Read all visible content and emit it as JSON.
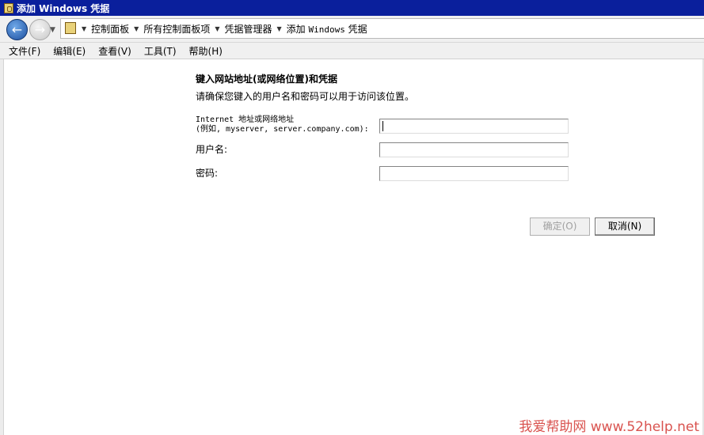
{
  "window": {
    "title": "添加 Windows 凭据"
  },
  "address_bar": {
    "crumbs": [
      "控制面板",
      "所有控制面板项",
      "凭据管理器"
    ],
    "current_prefix": "添加 ",
    "current_mono": "Windows",
    "current_suffix": " 凭据"
  },
  "menu": [
    "文件(F)",
    "编辑(E)",
    "查看(V)",
    "工具(T)",
    "帮助(H)"
  ],
  "form": {
    "heading": "键入网站地址(或网络位置)和凭据",
    "description": "请确保您键入的用户名和密码可以用于访问该位置。",
    "address_label_line1": "Internet 地址或网络地址",
    "address_label_line2": "(例如, myserver, server.company.com):",
    "username_label": "用户名:",
    "password_label": "密码:",
    "address_value": "",
    "username_value": "",
    "password_value": ""
  },
  "buttons": {
    "ok": "确定(O)",
    "cancel": "取消(N)"
  },
  "watermark": "我爱帮助网 www.52help.net"
}
